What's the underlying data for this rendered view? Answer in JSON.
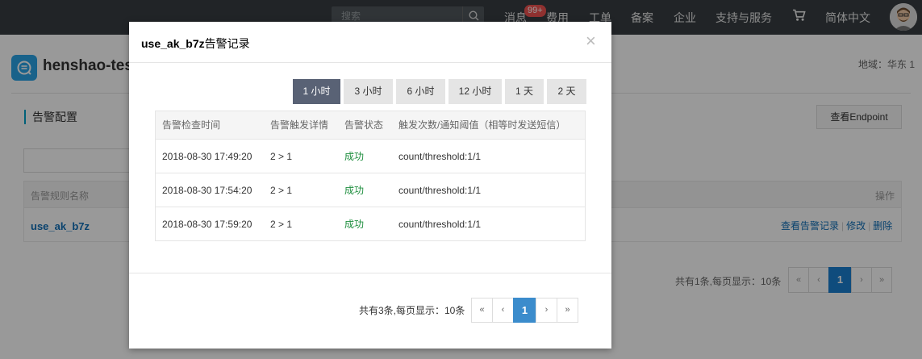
{
  "topnav": {
    "search_placeholder": "搜索",
    "badge": "99+",
    "items": [
      "消息",
      "费用",
      "工单",
      "备案",
      "企业",
      "支持与服务",
      "简体中文"
    ]
  },
  "page": {
    "app_title": "henshao-tes",
    "region": "地域：华东 1",
    "section_title": "告警配置",
    "endpoint_button": "查看Endpoint",
    "table": {
      "col_name": "告警规则名称",
      "col_action": "操作",
      "rule_name": "use_ak_b7z",
      "actions": [
        "查看告警记录",
        "修改",
        "删除"
      ]
    },
    "pager": {
      "summary": "共有1条,每页显示：10条",
      "buttons": [
        "«",
        "‹",
        "1",
        "›",
        "»"
      ]
    }
  },
  "modal": {
    "title_bold": "use_ak_b7z",
    "title_rest": "告警记录",
    "close": "×",
    "tabs": [
      "1 小时",
      "3 小时",
      "6 小时",
      "12 小时",
      "1 天",
      "2 天"
    ],
    "columns": [
      "告警检查时间",
      "告警触发详情",
      "告警状态",
      "触发次数/通知阈值（相等时发送短信）"
    ],
    "rows": [
      [
        "2018-08-30 17:49:20",
        "2 > 1",
        "成功",
        "count/threshold:1/1"
      ],
      [
        "2018-08-30 17:54:20",
        "2 > 1",
        "成功",
        "count/threshold:1/1"
      ],
      [
        "2018-08-30 17:59:20",
        "2 > 1",
        "成功",
        "count/threshold:1/1"
      ]
    ],
    "pager": {
      "summary": "共有3条,每页显示：10条",
      "buttons": [
        "«",
        "‹",
        "1",
        "›",
        "»"
      ]
    }
  }
}
